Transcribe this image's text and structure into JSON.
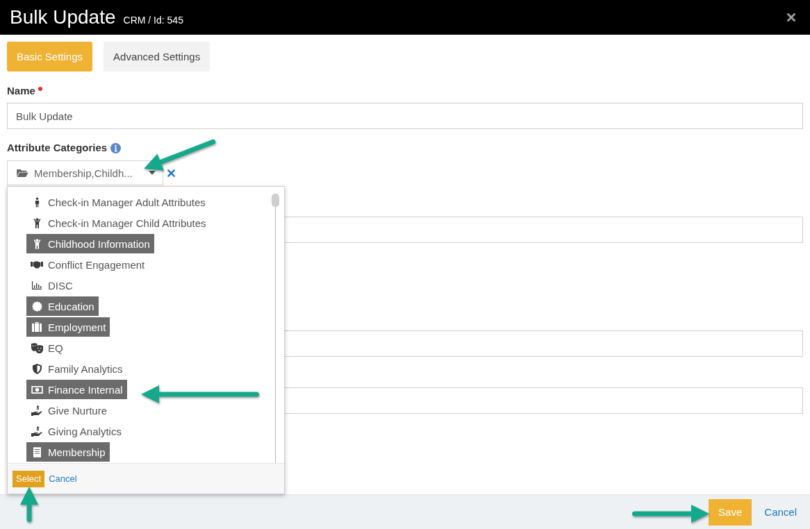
{
  "dialog": {
    "title": "Bulk Update",
    "subtitle": "CRM / Id: 545"
  },
  "tabs": [
    {
      "label": "Basic Settings",
      "selected": true
    },
    {
      "label": "Advanced Settings",
      "selected": false
    }
  ],
  "name_field": {
    "label": "Name",
    "required": true,
    "value": "Bulk Update"
  },
  "attribute_categories": {
    "label": "Attribute Categories",
    "value": "Membership,Childh...",
    "expanded": true,
    "options": [
      {
        "label": "Check-in Manager Adult Attributes",
        "selected": false
      },
      {
        "label": "Check-in Manager Child Attributes",
        "selected": false
      },
      {
        "label": "Childhood Information",
        "selected": true
      },
      {
        "label": "Conflict Engagement",
        "selected": false
      },
      {
        "label": "DISC",
        "selected": false
      },
      {
        "label": "Education",
        "selected": true
      },
      {
        "label": "Employment",
        "selected": true
      },
      {
        "label": "EQ",
        "selected": false
      },
      {
        "label": "Family Analytics",
        "selected": false
      },
      {
        "label": "Finance Internal",
        "selected": true
      },
      {
        "label": "Give Nurture",
        "selected": false
      },
      {
        "label": "Giving Analytics",
        "selected": false
      },
      {
        "label": "Membership",
        "selected": true
      }
    ],
    "select_button": "Select",
    "cancel_link": "Cancel"
  },
  "footer": {
    "save_button": "Save",
    "cancel_link": "Cancel"
  }
}
